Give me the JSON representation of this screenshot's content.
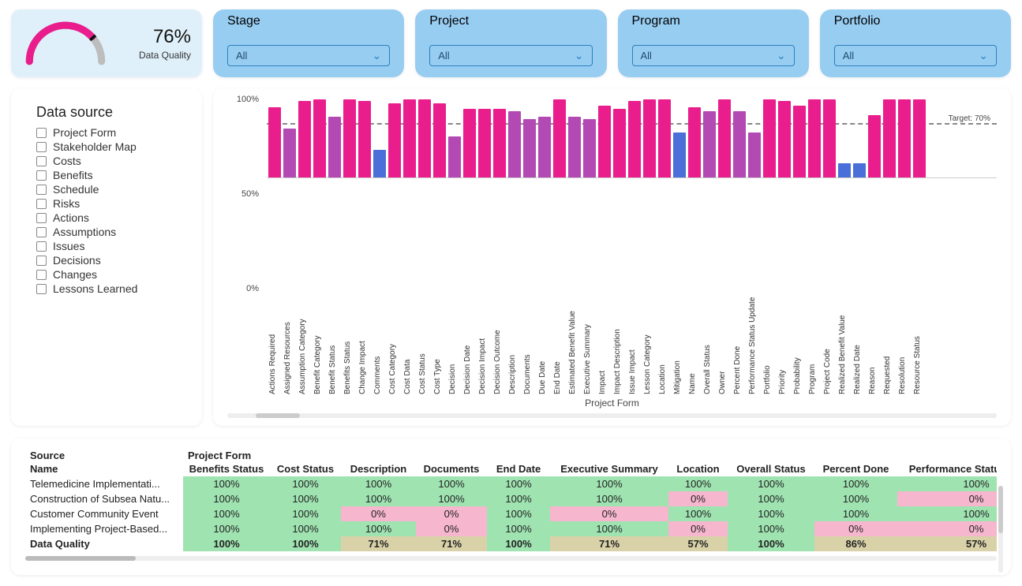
{
  "kpi": {
    "value": "76%",
    "label": "Data Quality",
    "percent": 76
  },
  "filters": [
    {
      "label": "Stage",
      "value": "All"
    },
    {
      "label": "Project",
      "value": "All"
    },
    {
      "label": "Program",
      "value": "All"
    },
    {
      "label": "Portfolio",
      "value": "All"
    }
  ],
  "data_source": {
    "title": "Data source",
    "items": [
      "Project Form",
      "Stakeholder Map",
      "Costs",
      "Benefits",
      "Schedule",
      "Risks",
      "Actions",
      "Assumptions",
      "Issues",
      "Decisions",
      "Changes",
      "Lessons Learned"
    ]
  },
  "chart_data": {
    "type": "bar",
    "title": "",
    "xlabel": "Project Form",
    "ylabel": "",
    "ylim": [
      0,
      105
    ],
    "yticks": [
      "0%",
      "50%",
      "100%"
    ],
    "target": {
      "value": 70,
      "label": "Target: 70%"
    },
    "categories": [
      "Actions Required",
      "Assigned Resources",
      "Assumption Category",
      "Benefit Category",
      "Benefit Status",
      "Benefits Status",
      "Change Impact",
      "Comments",
      "Cost Category",
      "Cost Data",
      "Cost Status",
      "Cost Type",
      "Decision",
      "Decision Date",
      "Decision Impact",
      "Decision Outcome",
      "Description",
      "Documents",
      "Due Date",
      "End Date",
      "Estimated Benefit Value",
      "Executive Summary",
      "Impact",
      "Impact Description",
      "Issue Impact",
      "Lesson Category",
      "Location",
      "Mitigation",
      "Name",
      "Overall Status",
      "Owner",
      "Percent Done",
      "Performance Status Update",
      "Portfolio",
      "Priority",
      "Probability",
      "Program",
      "Project Code",
      "Realized Benefit Value",
      "Realized Date",
      "Reason",
      "Requested",
      "Resolution",
      "Resource Status"
    ],
    "values": [
      90,
      63,
      98,
      100,
      78,
      100,
      98,
      35,
      95,
      100,
      100,
      95,
      53,
      88,
      88,
      88,
      85,
      75,
      78,
      100,
      78,
      75,
      92,
      88,
      98,
      100,
      100,
      58,
      90,
      85,
      100,
      85,
      58,
      100,
      98,
      92,
      100,
      100,
      18,
      18,
      80,
      100,
      100,
      100
    ],
    "colors": [
      "pk",
      "pp",
      "pk",
      "pk",
      "pp",
      "pk",
      "pk",
      "bl",
      "pk",
      "pk",
      "pk",
      "pk",
      "pp",
      "pk",
      "pk",
      "pk",
      "pp",
      "pp",
      "pp",
      "pk",
      "pp",
      "pp",
      "pk",
      "pk",
      "pk",
      "pk",
      "pk",
      "bl",
      "pk",
      "pp",
      "pk",
      "pp",
      "pp",
      "pk",
      "pk",
      "pk",
      "pk",
      "pk",
      "bl",
      "bl",
      "pk",
      "pk",
      "pk",
      "pk"
    ],
    "color_map": {
      "pk": "#e91e8c",
      "pp": "#b349b3",
      "bl": "#4a6fd8"
    }
  },
  "table": {
    "sup_headers": {
      "left": "Source",
      "right": "Project Form"
    },
    "name_col": "Name",
    "columns": [
      "Benefits Status",
      "Cost Status",
      "Description",
      "Documents",
      "End Date",
      "Executive Summary",
      "Location",
      "Overall Status",
      "Percent Done",
      "Performance Status Update"
    ],
    "rows": [
      {
        "name": "Telemedicine Implementati...",
        "cells": [
          "100%",
          "100%",
          "100%",
          "100%",
          "100%",
          "100%",
          "100%",
          "100%",
          "100%",
          "100%"
        ]
      },
      {
        "name": "Construction of Subsea Natu...",
        "cells": [
          "100%",
          "100%",
          "100%",
          "100%",
          "100%",
          "100%",
          "0%",
          "100%",
          "100%",
          "0%"
        ]
      },
      {
        "name": "Customer Community Event",
        "cells": [
          "100%",
          "100%",
          "0%",
          "0%",
          "100%",
          "0%",
          "100%",
          "100%",
          "100%",
          "100%"
        ]
      },
      {
        "name": "Implementing Project-Based...",
        "cells": [
          "100%",
          "100%",
          "100%",
          "0%",
          "100%",
          "100%",
          "0%",
          "100%",
          "0%",
          "0%"
        ]
      }
    ],
    "summary": {
      "name": "Data Quality",
      "cells": [
        "100%",
        "100%",
        "71%",
        "71%",
        "100%",
        "71%",
        "57%",
        "100%",
        "86%",
        "57%"
      ]
    },
    "good_color": "#9fe3b1",
    "bad_color": "#f6b6cd",
    "mid_color": "#d9d2a8"
  }
}
